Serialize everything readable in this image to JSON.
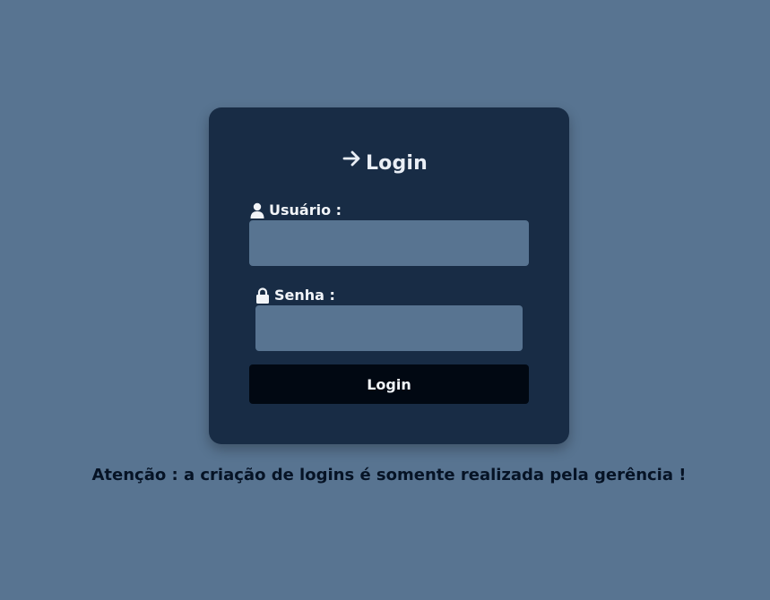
{
  "login_form": {
    "title": "Login",
    "title_icon": "arrow-right-icon",
    "username": {
      "label": "Usuário :",
      "icon": "user-icon",
      "value": "",
      "placeholder": ""
    },
    "password": {
      "label": "Senha :",
      "icon": "lock-icon",
      "value": "",
      "placeholder": ""
    },
    "submit_label": "Login"
  },
  "notice": "Atenção : a criação de logins é somente realizada pela gerência !",
  "colors": {
    "page_background": "#587491",
    "card_background": "#182c45",
    "input_background": "#587491",
    "button_background": "#010812",
    "text_light": "#f1f4f8",
    "notice_text": "#061325"
  }
}
